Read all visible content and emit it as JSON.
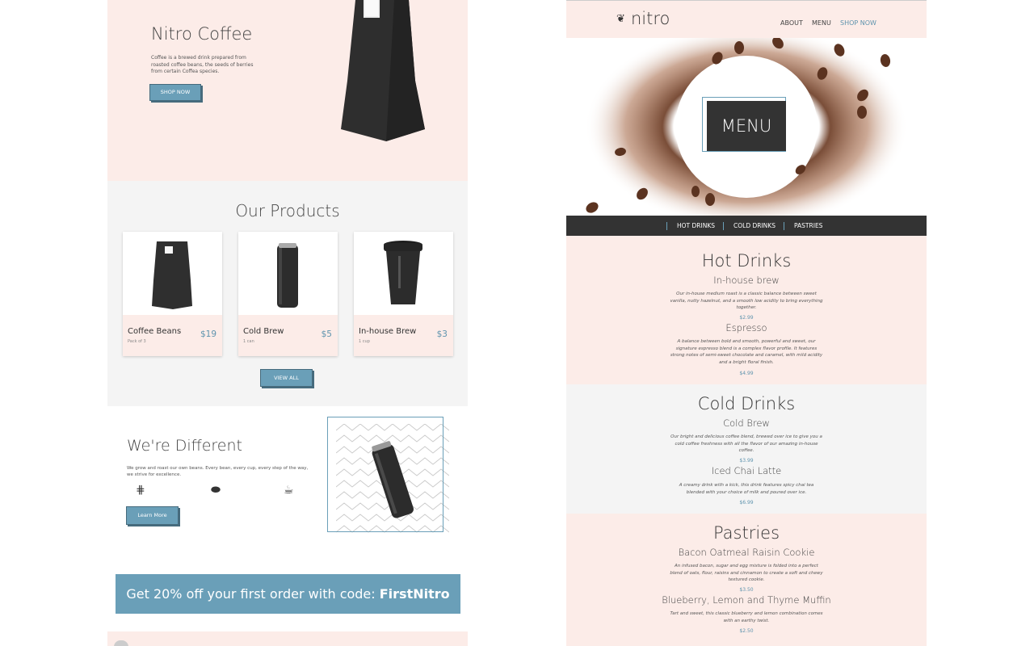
{
  "left_page": {
    "hero": {
      "title": "Nitro Coffee",
      "description": "Coffee is a brewed drink prepared from roasted coffee beans, the seeds of berries from certain Coffea species.",
      "button_label": "SHOP NOW"
    },
    "products": {
      "title": "Our Products",
      "items": [
        {
          "name": "Coffee Beans",
          "sub": "Pack of 3",
          "price": "$19"
        },
        {
          "name": "Cold Brew",
          "sub": "1 can",
          "price": "$5"
        },
        {
          "name": "In-house Brew",
          "sub": "1 cup",
          "price": "$3"
        }
      ],
      "view_all_label": "VIEW ALL"
    },
    "different": {
      "title": "We're Different",
      "description": "We grow and roast our own beans. Every bean, every cup, every step of the way, we strive for excellence.",
      "icons": [
        "crops-icon",
        "coffee-bean-icon",
        "coffee-cup-icon"
      ],
      "button_label": "Learn More"
    },
    "promo": {
      "text": "Get 20% off your first order with code: ",
      "code": "FirstNitro"
    }
  },
  "right_page": {
    "nav": {
      "logo": "nitro",
      "links": [
        "ABOUT",
        "MENU",
        "SHOP NOW"
      ]
    },
    "hero": {
      "label": "MENU"
    },
    "subnav": [
      "HOT DRINKS",
      "COLD DRINKS",
      "PASTRIES"
    ],
    "sections": [
      {
        "title": "Hot Drinks",
        "items": [
          {
            "name": "In-house brew",
            "description": "Our in-house medium roast is a classic balance between sweet vanilla, nutty hazelnut, and a smooth low acidity to bring everything together.",
            "price": "$2.99"
          },
          {
            "name": "Espresso",
            "description": "A balance between bold and smooth, powerful and sweet, our signature espresso blend is a complex flavor profile. It features strong notes of semi-sweet chocolate and caramel, with mild acidity and a bright floral finish.",
            "price": "$4.99"
          }
        ]
      },
      {
        "title": "Cold Drinks",
        "items": [
          {
            "name": "Cold Brew",
            "description": "Our bright and delicious coffee blend, brewed over ice to give you a cold coffee freshness with all the flavor of our amazing in-house coffee.",
            "price": "$3.99"
          },
          {
            "name": "Iced Chai Latte",
            "description": "A creamy drink with a kick, this drink features spicy chai tea blended with your choice of milk and poured over ice.",
            "price": "$6.99"
          }
        ]
      },
      {
        "title": "Pastries",
        "items": [
          {
            "name": "Bacon Oatmeal Raisin Cookie",
            "description": "An infused bacon, sugar and egg mixture is folded into a perfect blend of oats, flour, raisins and cinnamon to create a soft and chewy textured cookie.",
            "price": "$3.50"
          },
          {
            "name": "Blueberry, Lemon and Thyme Muffin",
            "description": "Tart and sweet, this classic blueberry and lemon combination comes with an earthy twist.",
            "price": "$2.50"
          }
        ]
      }
    ]
  },
  "colors": {
    "accent": "#6a9fb8",
    "pink_bg": "#fcece8",
    "gray_bg": "#f4f4f4",
    "dark": "#333333"
  }
}
